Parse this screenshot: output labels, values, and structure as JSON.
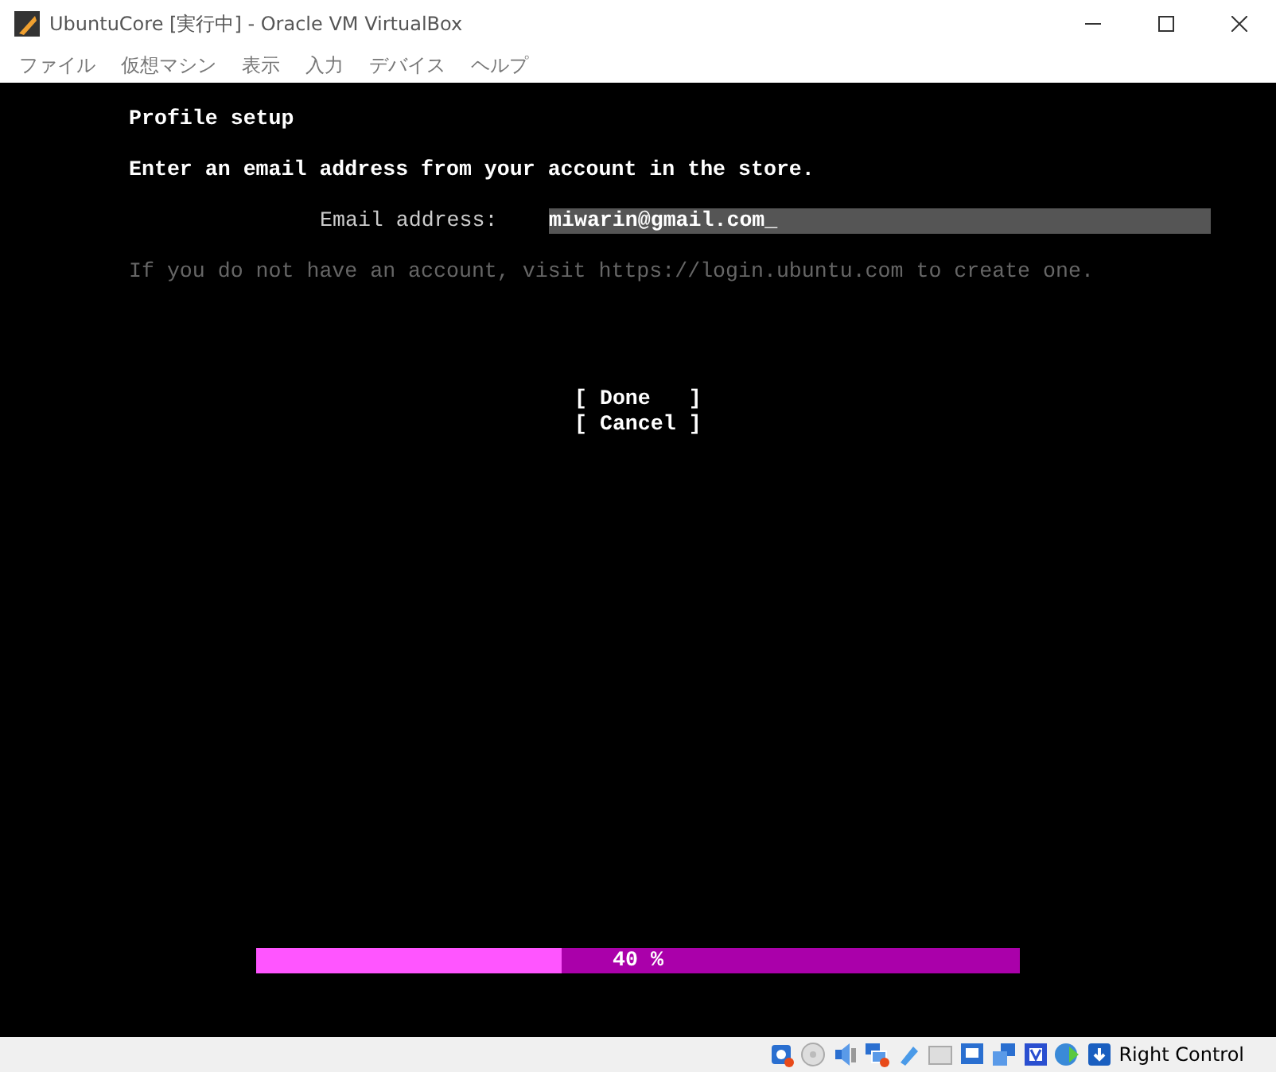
{
  "window": {
    "title": "UbuntuCore [実行中] - Oracle VM VirtualBox"
  },
  "menu": [
    "ファイル",
    "仮想マシン",
    "表示",
    "入力",
    "デバイス",
    "ヘルプ"
  ],
  "console": {
    "heading": "Profile setup",
    "instruction": "Enter an email address from your account in the store.",
    "email_label": "Email address:",
    "email_value": "miwarin@gmail.com_",
    "hint": "If you do not have an account, visit https://login.ubuntu.com to create one.",
    "buttons": [
      {
        "label": "[ Done   ]"
      },
      {
        "label": "[ Cancel ]"
      }
    ],
    "progress": {
      "level": 0.4,
      "reading": "40 %"
    }
  },
  "status_bar": {
    "host_key": "Right Control"
  }
}
